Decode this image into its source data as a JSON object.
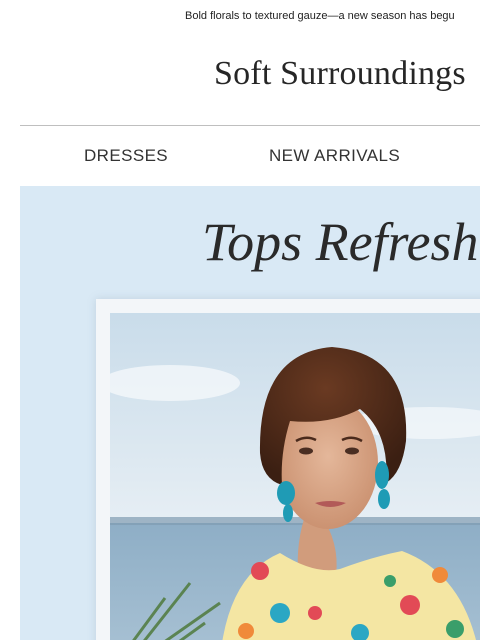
{
  "preheader": {
    "text": "Bold florals to textured gauze—a new season has begu"
  },
  "brand": {
    "logo_text": "Soft Surroundings"
  },
  "nav": {
    "items": [
      {
        "label": "DRESSES"
      },
      {
        "label": "NEW ARRIVALS"
      }
    ]
  },
  "hero": {
    "title": "Tops Refresh",
    "image_icon": "model-photo-icon"
  },
  "colors": {
    "hero_background": "#d9e9f5",
    "frame": "#f3f6f9",
    "text_dark": "#2a2a2a",
    "divider": "#bfbfbf"
  }
}
